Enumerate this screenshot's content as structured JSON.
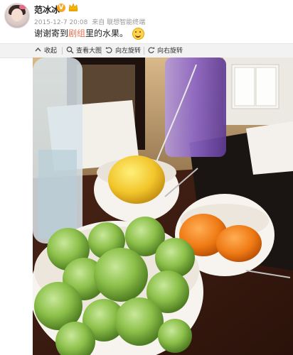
{
  "post": {
    "username": "范冰冰",
    "verify_mark": "V",
    "date": "2015-12-7 20:08",
    "source_prefix": "来自",
    "source": "联想智能终端",
    "text_before": "谢谢寄到",
    "text_link": "剧组",
    "text_after": "里的水果。"
  },
  "toolbar": {
    "collapse": "收起",
    "view_large": "查看大图",
    "rotate_left": "向左旋转",
    "rotate_right": "向右旋转"
  },
  "photo": {
    "subject": "fruit bowls"
  },
  "colors": {
    "link": "#eb7350",
    "toolbar_bg": "#f2f2f2"
  }
}
